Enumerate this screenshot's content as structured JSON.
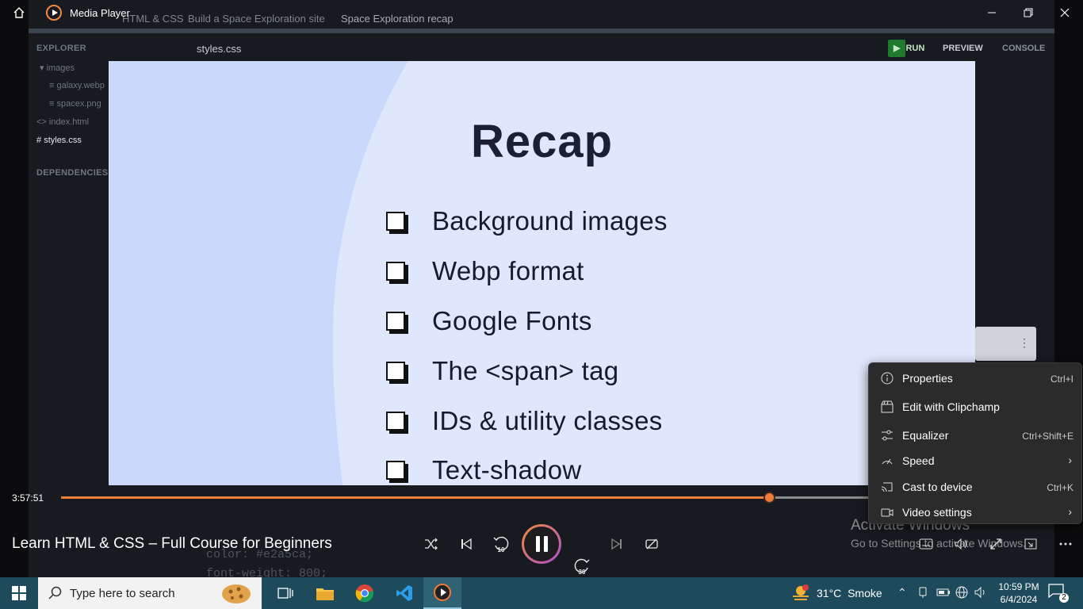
{
  "window": {
    "app_title": "Media Player",
    "icons": [
      "home-icon",
      "minimize-icon",
      "restore-icon",
      "close-icon"
    ]
  },
  "ide": {
    "breadcrumbs": [
      "HTML & CSS",
      "Build a Space Exploration site",
      "Space Exploration recap"
    ],
    "explorer_heading": "EXPLORER",
    "tree": [
      "images",
      "galaxy.webp",
      "spacex.png",
      "index.html",
      "styles.css"
    ],
    "dependencies_heading": "DEPENDENCIES",
    "open_file": "styles.css",
    "buttons": {
      "run": "RUN",
      "preview": "PREVIEW",
      "console": "CONSOLE"
    },
    "code_lines": [
      "color: #e2a5ca;",
      "font-weight: 800;"
    ]
  },
  "slide": {
    "title": "Recap",
    "items": [
      "Background images",
      "Webp format",
      "Google Fonts",
      "The <span> tag",
      "IDs & utility classes",
      "Text-shadow"
    ]
  },
  "player": {
    "current_time": "3:57:51",
    "progress_fraction": 0.875,
    "video_title": "Learn HTML & CSS – Full Course for Beginners",
    "skip_back_seconds": "10",
    "skip_forward_seconds": "30",
    "accent_color": "#f07a37"
  },
  "context_menu": {
    "items": [
      {
        "icon": "info-icon",
        "label": "Properties",
        "shortcut": "Ctrl+I"
      },
      {
        "icon": "clipchamp-icon",
        "label": "Edit with Clipchamp",
        "shortcut": ""
      },
      {
        "icon": "equalizer-icon",
        "label": "Equalizer",
        "shortcut": "Ctrl+Shift+E"
      },
      {
        "icon": "speed-icon",
        "label": "Speed",
        "shortcut": ""
      },
      {
        "icon": "cast-icon",
        "label": "Cast to device",
        "shortcut": "Ctrl+K"
      },
      {
        "icon": "video-settings-icon",
        "label": "Video settings",
        "shortcut": ""
      }
    ]
  },
  "watermark": {
    "title": "Activate Windows",
    "subtitle": "Go to Settings to activate Windows."
  },
  "taskbar": {
    "search_placeholder": "Type here to search",
    "weather_temp": "31°C",
    "weather_desc": "Smoke",
    "weather_badge": "1",
    "time": "10:59 PM",
    "date": "6/4/2024",
    "notification_count": "2"
  }
}
